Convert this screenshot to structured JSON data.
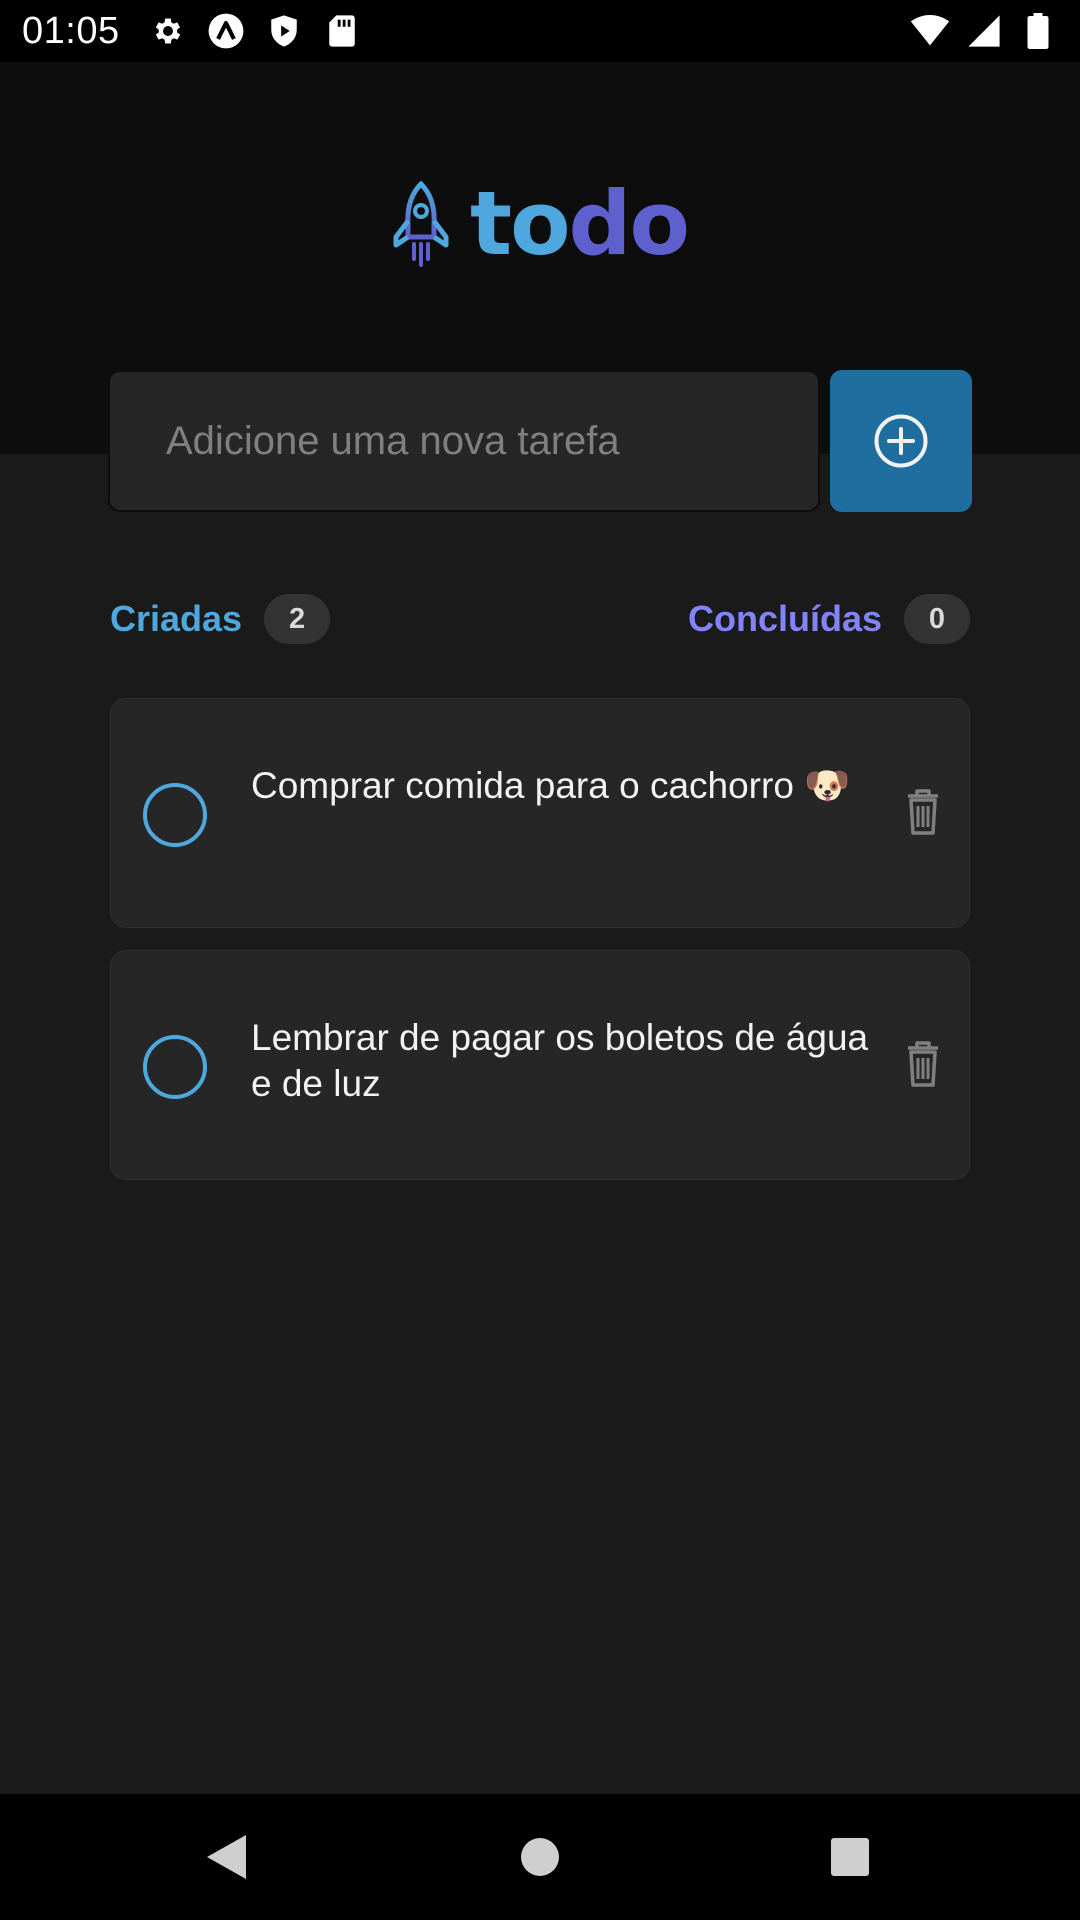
{
  "status_bar": {
    "time": "01:05",
    "left_icons": [
      "gear-icon",
      "app-a-icon",
      "shield-play-icon",
      "sd-card-icon"
    ],
    "right_icons": [
      "wifi-icon",
      "cell-signal-icon",
      "battery-icon"
    ]
  },
  "header": {
    "logo_text_part1": "to",
    "logo_text_part2": "do",
    "logo_icon": "rocket-icon"
  },
  "new_task": {
    "placeholder": "Adicione uma nova tarefa",
    "value": "",
    "add_button_icon": "plus-circle-icon"
  },
  "counters": {
    "created_label": "Criadas",
    "created_count": "2",
    "done_label": "Concluídas",
    "done_count": "0"
  },
  "tasks": [
    {
      "text": "Comprar comida para o cachorro 🐶",
      "completed": false
    },
    {
      "text": "Lembrar de pagar os boletos de água e de luz",
      "completed": false
    }
  ],
  "colors": {
    "blue": "#4ea8de",
    "purple": "#8284fa",
    "button": "#1e6f9f",
    "background": "#1a1a1a",
    "card": "#262626"
  },
  "nav_bar": {
    "icons": [
      "back-triangle-icon",
      "home-circle-icon",
      "recents-square-icon"
    ]
  }
}
